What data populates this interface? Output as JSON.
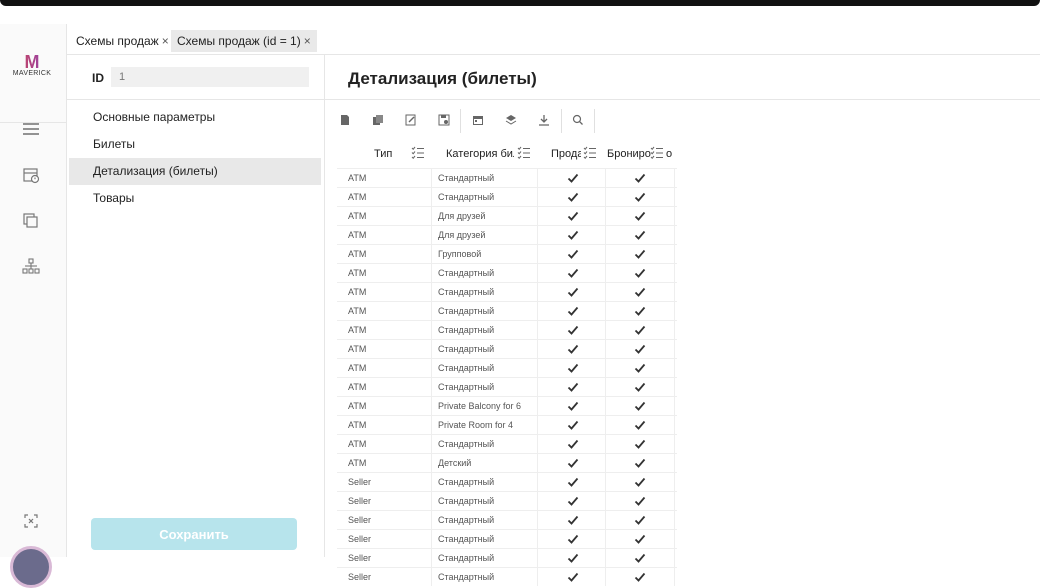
{
  "app": {
    "logo_letter": "M",
    "logo_word": "MAVERICK"
  },
  "tabs": [
    {
      "label": "Схемы продаж",
      "close": "×"
    },
    {
      "label": "Схемы продаж (id = 1)",
      "close": "×"
    }
  ],
  "record": {
    "id_label": "ID",
    "id_value": "1"
  },
  "nav": {
    "items": [
      "Основные параметры",
      "Билеты",
      "Детализация (билеты)",
      "Товары"
    ],
    "selected": 2
  },
  "save_label": "Сохранить",
  "page_title": "Детализация (билеты)",
  "toolbar_icons": [
    "file-icon",
    "copy-icon",
    "edit-icon",
    "save-icon",
    "calendar-icon",
    "layers-icon",
    "download-icon",
    "search-icon"
  ],
  "grid": {
    "headers": {
      "type": "Тип",
      "category": "Категория биле",
      "sale": "Прода",
      "booking": "Брониро",
      "trailing": "о"
    },
    "rows": [
      [
        "ATM",
        "Стандартный"
      ],
      [
        "ATM",
        "Стандартный"
      ],
      [
        "ATM",
        "Для друзей"
      ],
      [
        "ATM",
        "Для друзей"
      ],
      [
        "ATM",
        "Групповой"
      ],
      [
        "ATM",
        "Стандартный"
      ],
      [
        "ATM",
        "Стандартный"
      ],
      [
        "ATM",
        "Стандартный"
      ],
      [
        "ATM",
        "Стандартный"
      ],
      [
        "ATM",
        "Стандартный"
      ],
      [
        "ATM",
        "Стандартный"
      ],
      [
        "ATM",
        "Стандартный"
      ],
      [
        "ATM",
        "Private Balcony for 6"
      ],
      [
        "ATM",
        "Private Room for 4"
      ],
      [
        "ATM",
        "Стандартный"
      ],
      [
        "ATM",
        "Детский"
      ],
      [
        "Seller",
        "Стандартный"
      ],
      [
        "Seller",
        "Стандартный"
      ],
      [
        "Seller",
        "Стандартный"
      ],
      [
        "Seller",
        "Стандартный"
      ],
      [
        "Seller",
        "Стандартный"
      ],
      [
        "Seller",
        "Стандартный"
      ]
    ]
  },
  "colors": {
    "accent_button": "#b7e4ec",
    "selected_row": "#e8e8e8"
  }
}
